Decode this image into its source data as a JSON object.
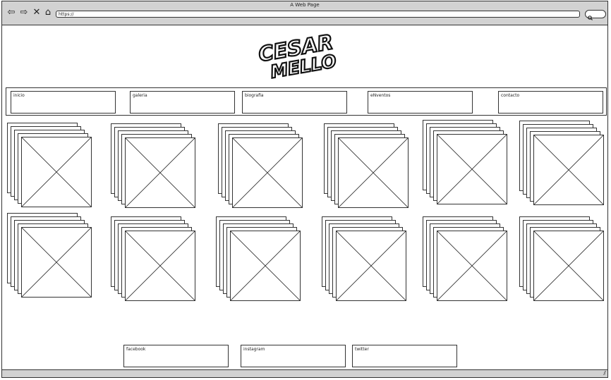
{
  "browser": {
    "title": "A Web Page",
    "url": "https://",
    "nav_icons": [
      "back-arrow-icon",
      "forward-arrow-icon",
      "close-x-icon",
      "home-icon"
    ]
  },
  "logo": {
    "line1": "CESAR",
    "line2": "MELLO"
  },
  "nav": {
    "items": [
      {
        "label": "inicio"
      },
      {
        "label": "galeria"
      },
      {
        "label": "biografia"
      },
      {
        "label": "eNventos"
      },
      {
        "label": "contacto"
      }
    ]
  },
  "gallery": {
    "rows": 2,
    "cols": 6,
    "item_type": "photo-stack-placeholder"
  },
  "footer": {
    "links": [
      {
        "label": "facebook"
      },
      {
        "label": "instagram"
      },
      {
        "label": "twitter"
      }
    ]
  }
}
